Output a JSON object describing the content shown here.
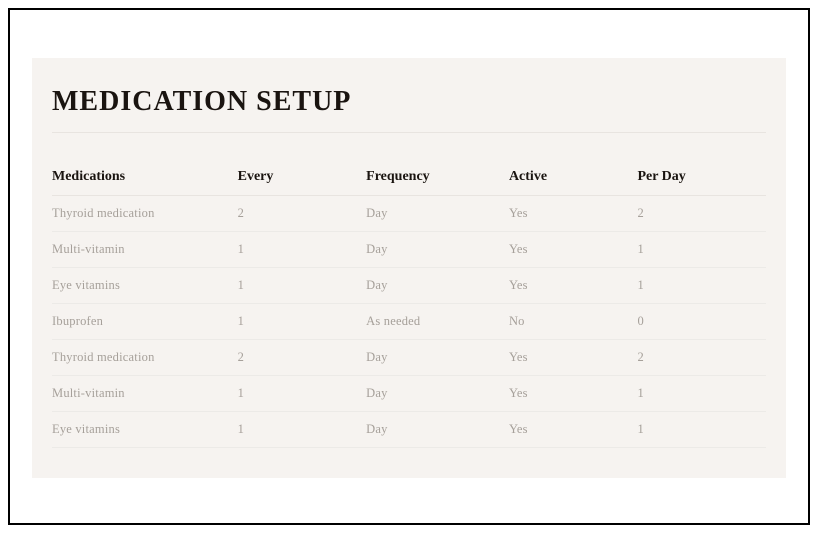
{
  "title": "MEDICATION SETUP",
  "columns": {
    "medications": "Medications",
    "every": "Every",
    "frequency": "Frequency",
    "active": "Active",
    "perday": "Per Day"
  },
  "rows": [
    {
      "medications": "Thyroid medication",
      "every": "2",
      "frequency": "Day",
      "active": "Yes",
      "perday": "2"
    },
    {
      "medications": "Multi-vitamin",
      "every": "1",
      "frequency": "Day",
      "active": "Yes",
      "perday": "1"
    },
    {
      "medications": "Eye vitamins",
      "every": "1",
      "frequency": "Day",
      "active": "Yes",
      "perday": "1"
    },
    {
      "medications": "Ibuprofen",
      "every": "1",
      "frequency": "As needed",
      "active": "No",
      "perday": "0"
    },
    {
      "medications": "Thyroid medication",
      "every": "2",
      "frequency": "Day",
      "active": "Yes",
      "perday": "2"
    },
    {
      "medications": "Multi-vitamin",
      "every": "1",
      "frequency": "Day",
      "active": "Yes",
      "perday": "1"
    },
    {
      "medications": "Eye vitamins",
      "every": "1",
      "frequency": "Day",
      "active": "Yes",
      "perday": "1"
    }
  ]
}
